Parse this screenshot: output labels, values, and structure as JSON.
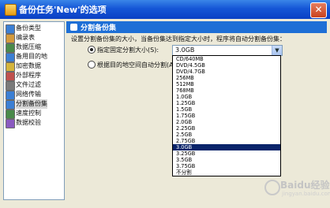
{
  "window": {
    "title": "备份任务'New'的选项"
  },
  "sidebar": {
    "items": [
      {
        "label": "备份类型"
      },
      {
        "label": "编录表"
      },
      {
        "label": "数据压缩"
      },
      {
        "label": "备用目的地"
      },
      {
        "label": "加密数据"
      },
      {
        "label": "外部程序"
      },
      {
        "label": "文件过滤"
      },
      {
        "label": "网络传输"
      },
      {
        "label": "分割备份集"
      },
      {
        "label": "速度控制"
      },
      {
        "label": "数据校验"
      }
    ],
    "selected_index": 8
  },
  "panel": {
    "title": "分割备份集",
    "description": "设置分割备份集的大小，当备份集达到指定大小时，程序将自动分割备份集："
  },
  "options": {
    "fixed_size_label": "指定固定分割大小(S):",
    "auto_label": "根据目的地空间自动分割(A)"
  },
  "size_select": {
    "value": "3.0GB",
    "options": [
      "CD/640MB",
      "DVD/4.5GB",
      "DVD/4.7GB",
      "256MB",
      "512MB",
      "768MB",
      "1.0GB",
      "1.25GB",
      "1.5GB",
      "1.75GB",
      "2.0GB",
      "2.25GB",
      "2.5GB",
      "2.75GB",
      "3.0GB",
      "3.25GB",
      "3.5GB",
      "3.75GB",
      "不分割"
    ],
    "highlighted_index": 14
  },
  "watermark": {
    "text": "Baidu经验",
    "sub": "jingyan.baidu.com"
  }
}
